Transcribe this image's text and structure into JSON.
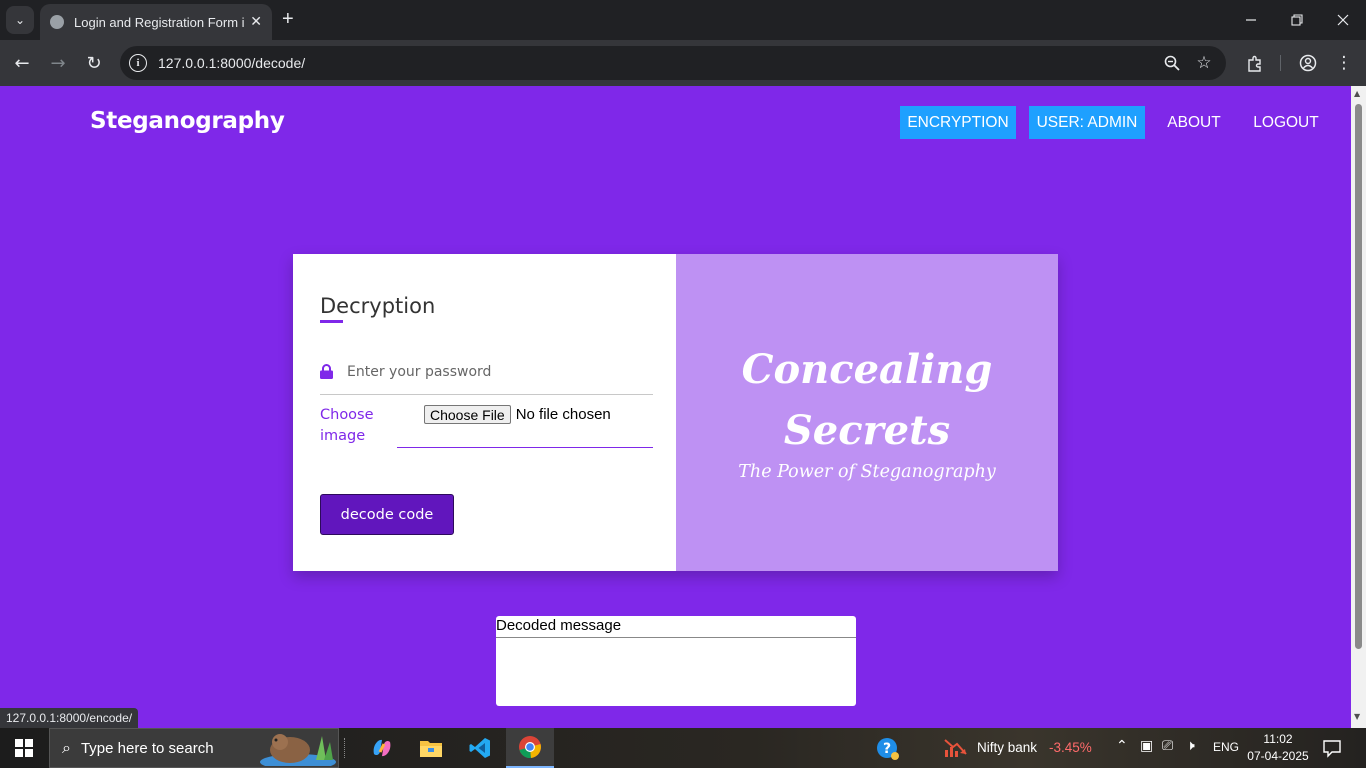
{
  "browser": {
    "tab_title": "Login and Registration Form in",
    "tab_close": "✕",
    "new_tab": "+",
    "url": "127.0.0.1:8000/decode/",
    "status_url": "127.0.0.1:8000/encode/"
  },
  "page": {
    "brand": "Steganography",
    "nav": [
      "ENCRYPTION",
      "USER: ADMIN",
      "ABOUT",
      "LOGOUT"
    ],
    "form": {
      "title": "Decryption",
      "password_placeholder": "Enter your password",
      "choose_label": "Choose image",
      "file_button": "Choose File",
      "file_status": "No file chosen",
      "submit": "decode code"
    },
    "hero": {
      "line1": "Concealing",
      "line2": "Secrets",
      "subtitle": "The Power of Steganography"
    },
    "decoded_label": "Decoded message"
  },
  "taskbar": {
    "search_placeholder": "Type here to search",
    "ticker_name": "Nifty bank",
    "ticker_change": "-3.45%",
    "lang": "ENG",
    "time": "11:02",
    "date": "07-04-2025"
  },
  "colors": {
    "page_bg": "#7f28e9",
    "nav_pill": "#1ea0ff",
    "hero_panel": "#be91f3",
    "button": "#6116bd",
    "ticker_negative": "#ff6b6b"
  }
}
